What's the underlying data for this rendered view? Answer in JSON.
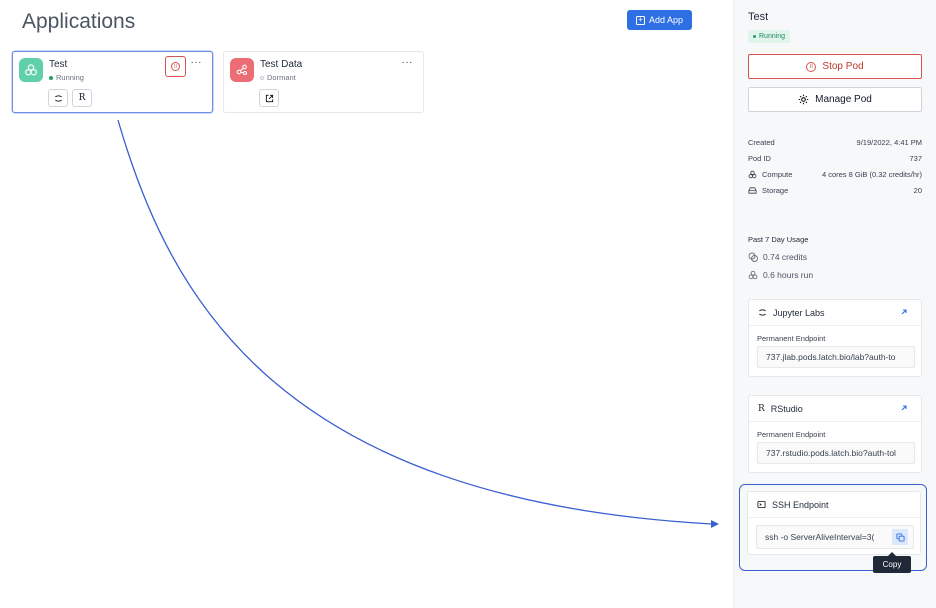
{
  "main": {
    "title": "Applications",
    "add_app_label": "Add App",
    "apps": [
      {
        "name": "Test",
        "status": "Running",
        "status_color": "#22a06b",
        "icon_bg": "#5fd0a8",
        "chips": [
          "jupyter-icon",
          "R"
        ]
      },
      {
        "name": "Test Data",
        "status": "Dormant",
        "status_color": "#c4c8ce",
        "icon_bg": "#ec6d74",
        "chips": [
          "external-link-icon"
        ]
      }
    ]
  },
  "panel": {
    "title": "Test",
    "badge": "Running",
    "stop_label": "Stop Pod",
    "manage_label": "Manage Pod",
    "details": {
      "created_label": "Created",
      "created_value": "9/19/2022, 4:41 PM",
      "pod_id_label": "Pod ID",
      "pod_id_value": "737",
      "compute_label": "Compute",
      "compute_value": "4 cores 8 GiB (0.32 credits/hr)",
      "storage_label": "Storage",
      "storage_value": "20"
    },
    "usage": {
      "title": "Past 7 Day Usage",
      "credits": "0.74 credits",
      "hours": "0.6 hours run"
    },
    "jupyter": {
      "title": "Jupyter Labs",
      "endpoint_label": "Permanent Endpoint",
      "endpoint_value": "737.jlab.pods.latch.bio/lab?auth-to"
    },
    "rstudio": {
      "title": "RStudio",
      "endpoint_label": "Permanent Endpoint",
      "endpoint_value": "737.rstudio.pods.latch.bio?auth-tol"
    },
    "ssh": {
      "title": "SSH Endpoint",
      "value": "ssh -o ServerAliveInterval=3(",
      "copy_tooltip": "Copy"
    }
  },
  "colors": {
    "accent": "#2f6fe4",
    "danger": "#d9534f",
    "annotation": "#3b5fd1"
  }
}
